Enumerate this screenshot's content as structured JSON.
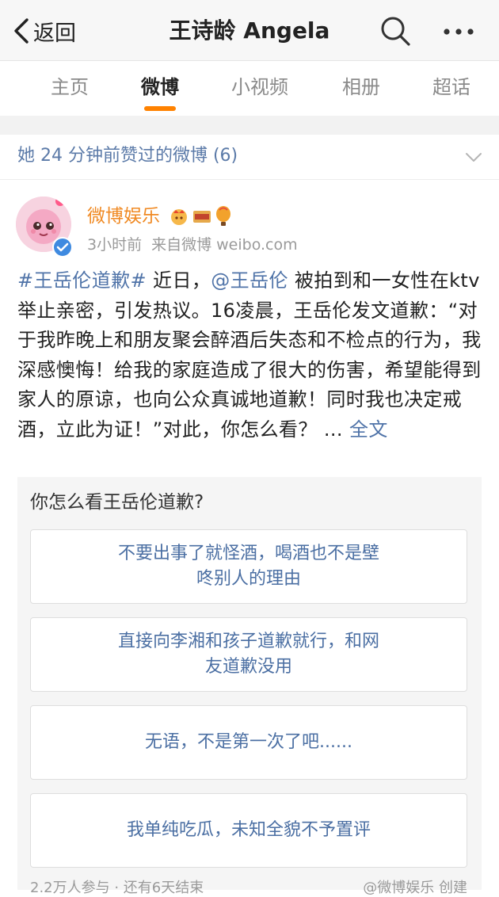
{
  "nav": {
    "back_label": "返回",
    "title": "王诗龄 Angela"
  },
  "tabs": [
    {
      "label": "主页",
      "active": false
    },
    {
      "label": "微博",
      "active": true
    },
    {
      "label": "小视频",
      "active": false
    },
    {
      "label": "相册",
      "active": false
    },
    {
      "label": "超话",
      "active": false
    }
  ],
  "liked_banner": {
    "text": "她 24 分钟前赞过的微博 (6)"
  },
  "post": {
    "author": "微博娱乐",
    "time": "3小时前",
    "source": "来自微博 weibo.com",
    "hashtag": "#王岳伦道歉#",
    "text_1": " 近日，",
    "mention": "@王岳伦",
    "text_2": " 被拍到和一女性在ktv举止亲密，引发热议。16凌晨，王岳伦发文道歉：“对于我昨晚上和朋友聚会醉酒后失态和不检点的行为，我深感懊悔！给我的家庭造成了很大的伤害，希望能得到家人的原谅，也向公众真诚地道歉！同时我也决定戒酒，立此为证！”对此，你怎么看？ ... ",
    "full_text_link": "全文"
  },
  "poll": {
    "question": "你怎么看王岳伦道歉?",
    "options": [
      {
        "line1": "不要出事了就怪酒，喝酒也不是壁",
        "line2": "咚别人的理由"
      },
      {
        "line1": "直接向李湘和孩子道歉就行，和网",
        "line2": "友道歉没用"
      },
      {
        "line1": "无语，不是第一次了吧......",
        "line2": ""
      },
      {
        "line1": "我单纯吃瓜，未知全貌不予置评",
        "line2": ""
      }
    ],
    "footer_left": "2.2万人参与 · 还有6天结束",
    "footer_right": "@微博娱乐 创建"
  },
  "colors": {
    "accent": "#ff8200",
    "link": "#4f73a8",
    "author": "#f08a24"
  }
}
